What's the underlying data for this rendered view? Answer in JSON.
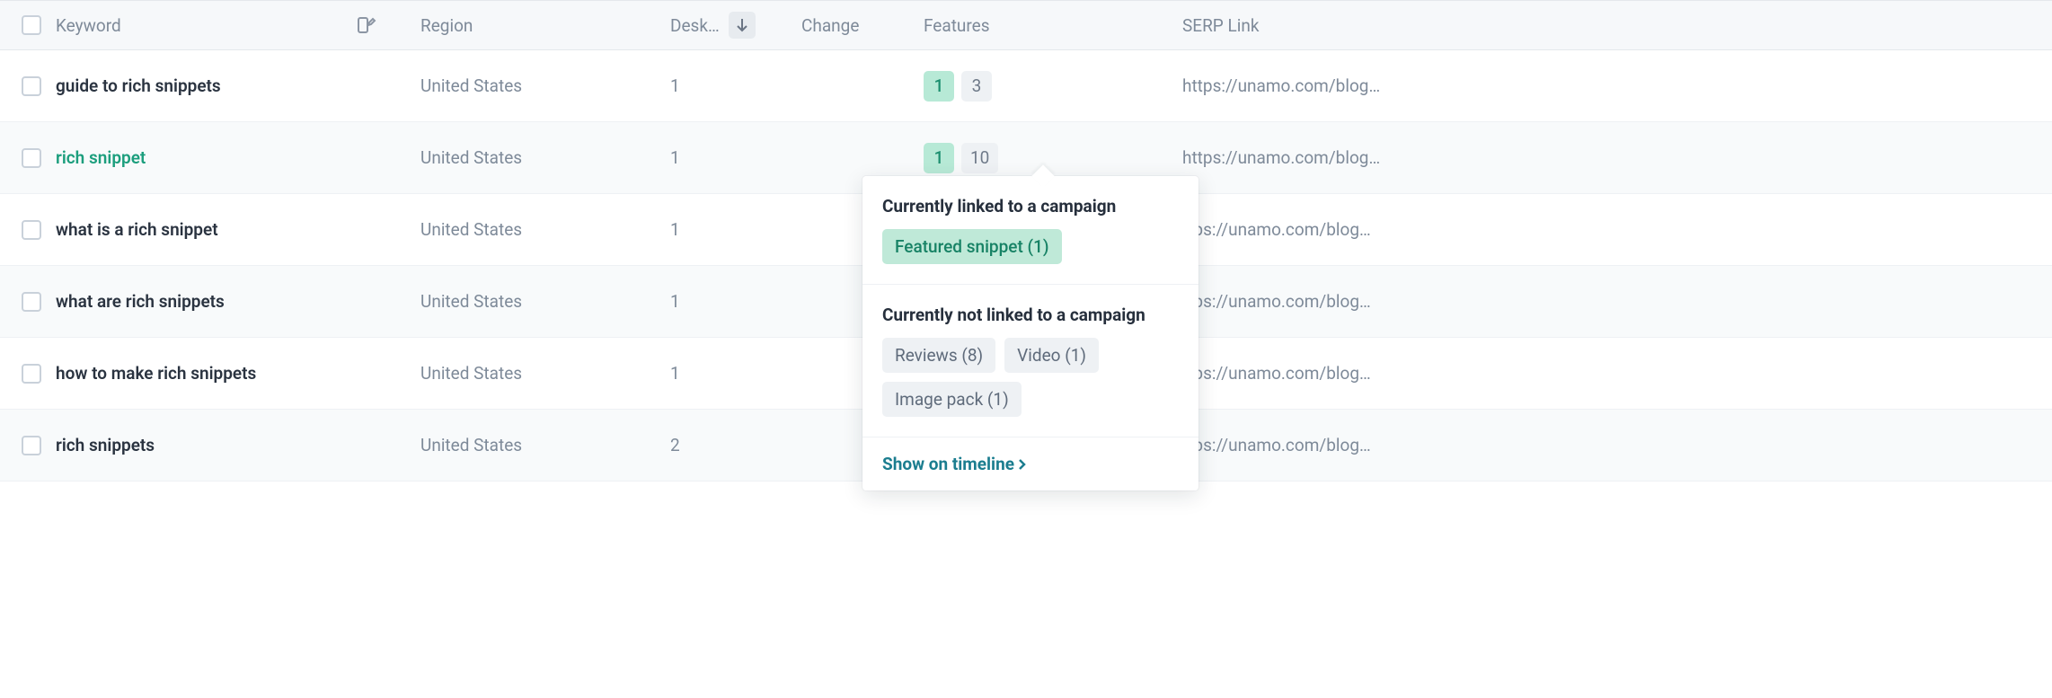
{
  "columns": {
    "keyword": "Keyword",
    "region": "Region",
    "desk": "Desk…",
    "change": "Change",
    "features": "Features",
    "serp": "SERP Link"
  },
  "rows": [
    {
      "keyword": "guide to rich snippets",
      "highlight": false,
      "region": "United States",
      "desk": "1",
      "change": "",
      "features": [
        "1",
        "3"
      ],
      "serp": "https://unamo.com/blog…"
    },
    {
      "keyword": "rich snippet",
      "highlight": true,
      "region": "United States",
      "desk": "1",
      "change": "",
      "features": [
        "1",
        "10"
      ],
      "serp": "https://unamo.com/blog…"
    },
    {
      "keyword": "what is a rich snippet",
      "highlight": false,
      "region": "United States",
      "desk": "1",
      "change": "",
      "features": [],
      "serp": "ttps://unamo.com/blog…"
    },
    {
      "keyword": "what are rich snippets",
      "highlight": false,
      "region": "United States",
      "desk": "1",
      "change": "",
      "features": [],
      "serp": "ttps://unamo.com/blog…"
    },
    {
      "keyword": "how to make rich snippets",
      "highlight": false,
      "region": "United States",
      "desk": "1",
      "change": "",
      "features": [],
      "serp": "ttps://unamo.com/blog…"
    },
    {
      "keyword": "rich snippets",
      "highlight": false,
      "region": "United States",
      "desk": "2",
      "change": "",
      "features": [],
      "serp": "ttps://unamo.com/blog…"
    }
  ],
  "popover": {
    "linked_title": "Currently linked to a campaign",
    "linked_tags": [
      "Featured snippet (1)"
    ],
    "unlinked_title": "Currently not linked to a campaign",
    "unlinked_tags": [
      "Reviews (8)",
      "Video (1)",
      "Image pack (1)"
    ],
    "timeline": "Show on timeline"
  }
}
